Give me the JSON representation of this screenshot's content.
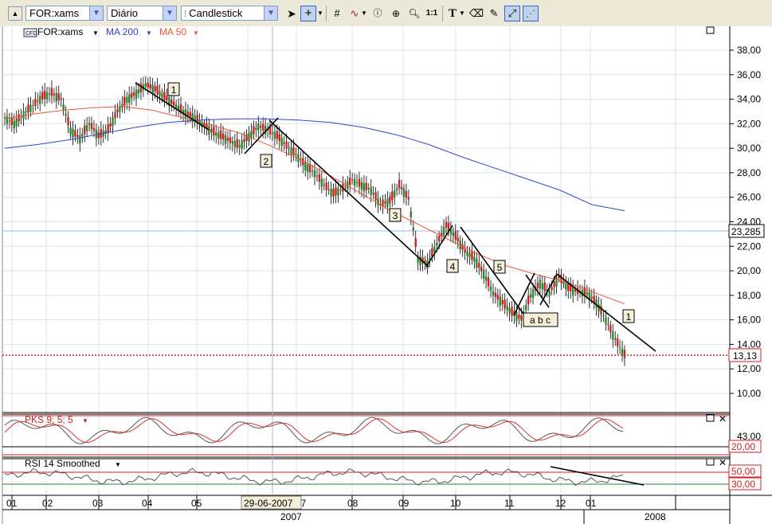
{
  "toolbar": {
    "symbol": "FOR:xams",
    "interval": "Diário",
    "chart_type": "Candlestick",
    "tools": [
      "pointer-icon",
      "crosshair-icon",
      "grid-icon",
      "indicator-icon",
      "info-icon",
      "zoom-icon",
      "one-to-one-icon",
      "text-tool-icon",
      "eraser-icon",
      "format-icon",
      "trendline-icon",
      "magnet-icon"
    ],
    "one_to_one": "1:1",
    "text_tool": "T"
  },
  "legend": {
    "symbol": "FOR:xams",
    "ma200": "MA 200",
    "ma50": "MA 50",
    "cfd": "CFD"
  },
  "colors": {
    "ma200": "#3344cc",
    "ma50": "#ee5533",
    "candle_up": "#2a8a2a",
    "candle_down": "#cc2222",
    "pks_fast": "#555555",
    "pks_slow": "#dd3333",
    "grid": "#dde3ec",
    "crosshair": "#9bbbe0"
  },
  "price_axis": {
    "ticks": [
      "38,00",
      "36,00",
      "34,00",
      "32,00",
      "30,00",
      "28,00",
      "26,00",
      "24,00",
      "22,00",
      "20,00",
      "18,00",
      "16,00",
      "14,00",
      "12,00",
      "10,00"
    ],
    "current_price": "23,285",
    "last_price": "13,13"
  },
  "wave_labels": [
    "1",
    "2",
    "3",
    "4",
    "5",
    "a b c",
    "1"
  ],
  "pks": {
    "label": "PKS 9; 5; 5",
    "ticks": [
      "43,00",
      "20,00"
    ]
  },
  "rsi": {
    "label": "RSI 14 Smoothed",
    "ticks": [
      "50,00",
      "30,00"
    ]
  },
  "time_axis": {
    "months": [
      "01",
      "02",
      "03",
      "04",
      "05",
      "06",
      "07",
      "08",
      "09",
      "10",
      "11",
      "12",
      "01"
    ],
    "cursor_date": "29-06-2007",
    "years": [
      "2007",
      "2008"
    ]
  },
  "chart_data": {
    "type": "candlestick",
    "ylim": [
      9,
      39
    ],
    "series": [
      {
        "name": "FOR:xams",
        "values": [
          32.5,
          32,
          32.8,
          33.5,
          34.2,
          34.5,
          34,
          31.5,
          30.8,
          32,
          31,
          31.5,
          33,
          34,
          34.5,
          35.2,
          34.8,
          34.2,
          33.6,
          33,
          32.6,
          32,
          31.4,
          31,
          30.6,
          30.2,
          31,
          31.8,
          31.5,
          31,
          30.2,
          29.5,
          28.6,
          28,
          27,
          26.3,
          26.7,
          27.4,
          27,
          26.6,
          25.4,
          25.7,
          27,
          25.9,
          21,
          20.6,
          22.2,
          23.7,
          22.8,
          21.6,
          21,
          19.8,
          18.2,
          17.4,
          16.6,
          16.1,
          18,
          19,
          18.2,
          19.5,
          18.6,
          18.3,
          18.2,
          17.4,
          16,
          14.4,
          13.13
        ]
      },
      {
        "name": "MA 200",
        "values": [
          30,
          30.3,
          30.7,
          31.2,
          31.7,
          32.1,
          32.3,
          32.4,
          32.4,
          32.3,
          32.1,
          31.7,
          31.1,
          30.3,
          29.3,
          28.4,
          27.5,
          26.6,
          25.4,
          24.9
        ]
      },
      {
        "name": "MA 50",
        "values": [
          32.4,
          32.8,
          33.1,
          33.3,
          33.4,
          33.1,
          32.5,
          31.9,
          31.2,
          30.2,
          29.1,
          27.8,
          26.4,
          25,
          23.8,
          22.6,
          21.4,
          20.4,
          19.7,
          19.1,
          18.2,
          17.3
        ]
      }
    ]
  }
}
